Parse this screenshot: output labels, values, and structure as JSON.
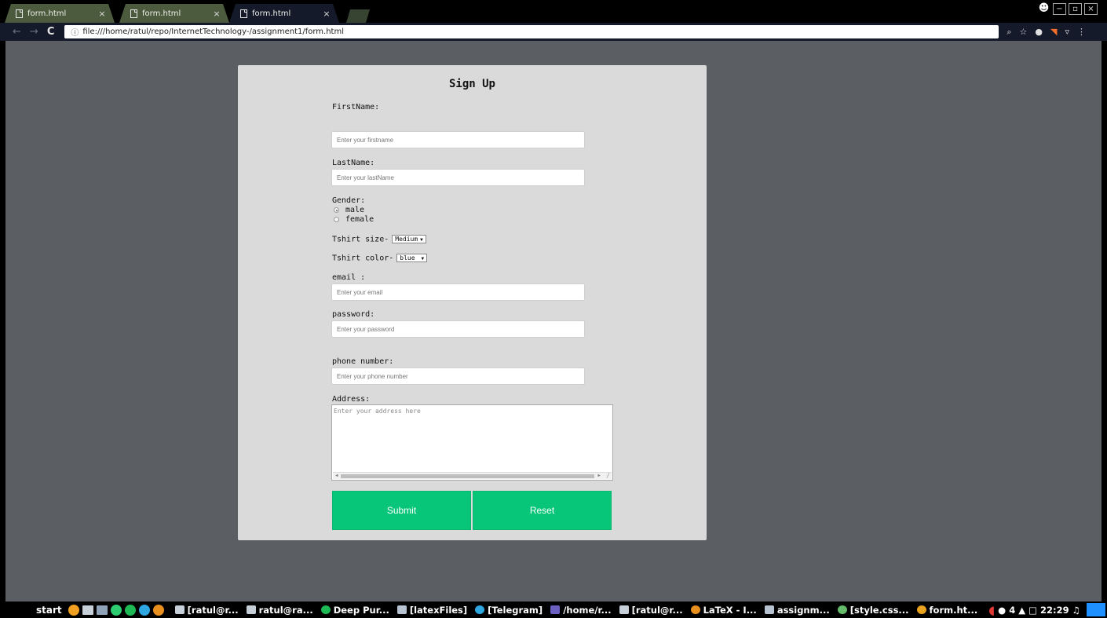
{
  "browser": {
    "tabs": [
      {
        "label": "form.html",
        "close": "×"
      },
      {
        "label": "form.html",
        "close": "×"
      },
      {
        "label": "form.html",
        "close": "×"
      }
    ],
    "url_info": "ⓘ",
    "url": "file:///home/ratul/repo/InternetTechnology-/assignment1/form.html",
    "nav": {
      "back": "←",
      "forward": "→",
      "reload": "C"
    },
    "window_controls": {
      "profile": "☻",
      "minimize": "−",
      "restore": "▫",
      "close": "×"
    },
    "toolbar_icons": [
      "zoom-icon",
      "bookmark-star-icon",
      "extension-icon",
      "extension-orange-icon",
      "pocket-icon",
      "menu-icon"
    ]
  },
  "form": {
    "title": "Sign Up",
    "firstname": {
      "label": "FirstName:",
      "placeholder": "Enter your firstname"
    },
    "lastname": {
      "label": "LastName:",
      "placeholder": "Enter your lastName"
    },
    "gender": {
      "label": "Gender:",
      "options": [
        "male",
        "female"
      ],
      "selected": "male"
    },
    "tshirt_size": {
      "label": "Tshirt size-",
      "value": "Medium"
    },
    "tshirt_color": {
      "label": "Tshirt color-",
      "value": "blue"
    },
    "email": {
      "label": "email :",
      "placeholder": "Enter your email"
    },
    "password": {
      "label": "password:",
      "placeholder": "Enter your password"
    },
    "phone": {
      "label": "phone number:",
      "placeholder": "Enter your phone number"
    },
    "address": {
      "label": "Address:",
      "placeholder": "Enter your address here"
    },
    "submit_label": "Submit",
    "reset_label": "Reset"
  },
  "taskbar": {
    "start": "start",
    "tasks": [
      {
        "label": "[ratul@r...",
        "icon": "terminal-icon"
      },
      {
        "label": "ratul@ra...",
        "icon": "terminal-icon"
      },
      {
        "label": "Deep Pur...",
        "icon": "spotify-icon"
      },
      {
        "label": "[latexFiles]",
        "icon": "folder-icon"
      },
      {
        "label": "[Telegram]",
        "icon": "telegram-icon"
      },
      {
        "label": "/home/r...",
        "icon": "image-viewer-icon"
      },
      {
        "label": "[ratul@r...",
        "icon": "terminal-icon"
      },
      {
        "label": "LaTeX - I...",
        "icon": "firefox-icon"
      },
      {
        "label": "assignm...",
        "icon": "folder-icon"
      },
      {
        "label": "[style.css...",
        "icon": "atom-icon"
      },
      {
        "label": "form.ht...",
        "icon": "chrome-icon"
      }
    ],
    "tray": {
      "count": "4",
      "clock": "22:29"
    },
    "colors": {
      "accent": "#07c679",
      "background": "#5b5f64",
      "card": "#dadada"
    }
  }
}
